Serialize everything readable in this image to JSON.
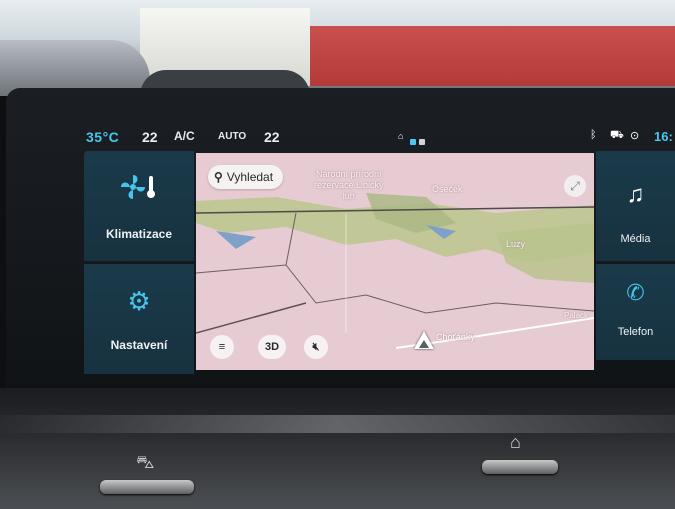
{
  "status_bar": {
    "outside_temp": "35°C",
    "temp_left": "22",
    "ac_label": "A/C",
    "auto_label": "AUTO",
    "temp_right": "22",
    "clock": "16:"
  },
  "left_tiles": [
    {
      "label": "Klimatizace",
      "icon": "climate-icon"
    },
    {
      "label": "Nastavení",
      "icon": "gear-icon"
    }
  ],
  "right_tiles": [
    {
      "label": "Média",
      "icon": "music-note-icon"
    },
    {
      "label": "Telefon",
      "icon": "phone-icon"
    }
  ],
  "map": {
    "search_label": "Vyhledat",
    "labels": {
      "rezervace": "Národní přírodní rezervace Libický luh",
      "rezervace_lines": [
        "Národní přírodní",
        "rezervace Libický",
        "luh"
      ],
      "osecek": "Osečék",
      "luzy": "Luzy",
      "cholanky": "Choťánky",
      "palack": "Palack"
    },
    "buttons": {
      "menu": "menu-icon",
      "three_d": "3D",
      "mute": "mute-icon",
      "expand": "expand-icon"
    }
  },
  "colors": {
    "accent": "#48c7ef",
    "tile_bg": "#1a3a4a",
    "map_pink": "#e8cfd4",
    "map_green": "#b9c58e"
  }
}
